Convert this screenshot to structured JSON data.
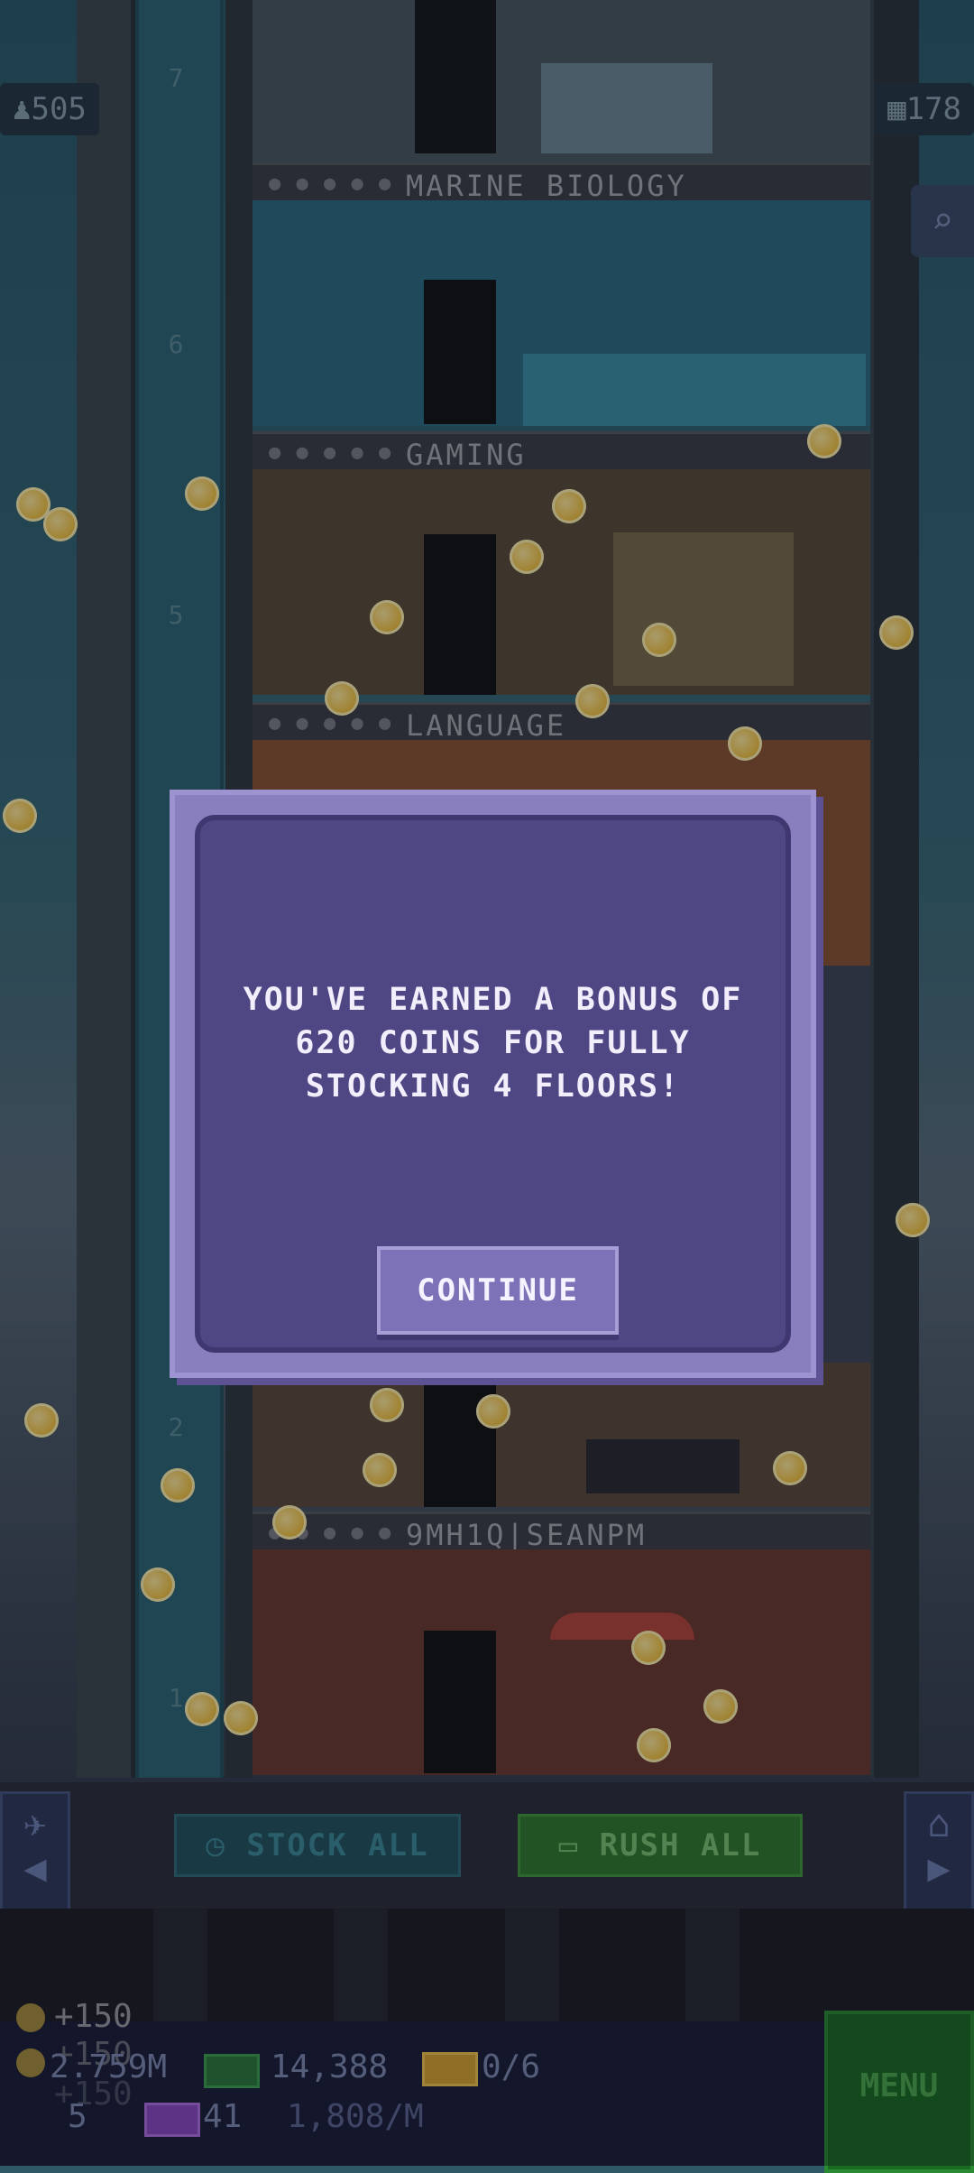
{
  "hud": {
    "population": "505",
    "floors_count": "178",
    "search_icon": "search-icon"
  },
  "floor_numbers": [
    "7",
    "6",
    "5",
    "2",
    "1"
  ],
  "floors": [
    {
      "name": "MARINE BIOLOGY"
    },
    {
      "name": "GAMING"
    },
    {
      "name": "LANGUAGE"
    },
    {
      "name": "9MH1Q|SEANPM"
    }
  ],
  "modal": {
    "message_line1": "YOU'VE EARNED A BONUS OF",
    "message_line2": "620 COINS FOR FULLY",
    "message_line3": "STOCKING 4 FLOORS!",
    "continue_label": "CONTINUE"
  },
  "toolbar": {
    "stock_all_label": "STOCK ALL",
    "rush_all_label": "RUSH ALL"
  },
  "bottom": {
    "coin_gain_1": "+150",
    "coin_gain_2": "+150",
    "coin_gain_3": "+150",
    "coins": "2.759M",
    "bux": "14,388",
    "vip": "0/6",
    "elevator_level": "5",
    "stock_items": "41",
    "income_rate": "1,808/M",
    "menu_label": "MENU"
  },
  "colors": {
    "modal_bg": "#4f4784",
    "modal_border": "#8a7fbe",
    "rush_green": "#2f7a2c",
    "coin_gold": "#f3c441"
  }
}
